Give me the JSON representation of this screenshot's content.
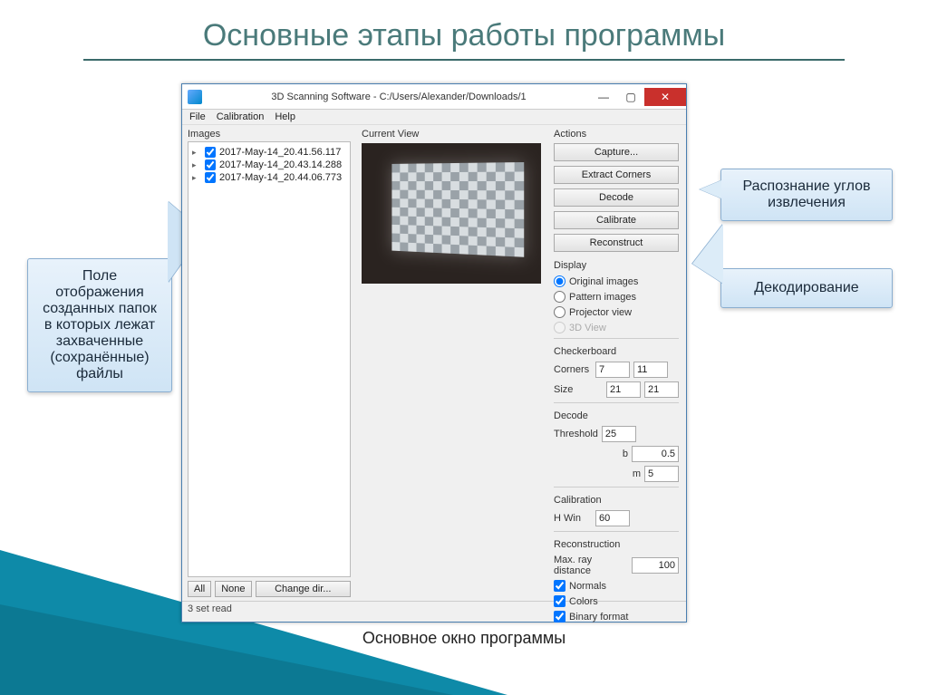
{
  "slide": {
    "title": "Основные этапы работы программы",
    "caption": "Основное окно программы"
  },
  "callouts": {
    "left": "Поле отображения созданных папок в которых лежат захваченные (сохранённые) файлы",
    "r1": "Распознание углов извлечения",
    "r2": "Декодирование"
  },
  "window": {
    "title": "3D Scanning Software - C:/Users/Alexander/Downloads/1",
    "menu": {
      "file": "File",
      "calibration": "Calibration",
      "help": "Help"
    },
    "status": "3 set read"
  },
  "left_panel": {
    "label": "Images",
    "items": [
      "2017-May-14_20.41.56.117",
      "2017-May-14_20.43.14.288",
      "2017-May-14_20.44.06.773"
    ],
    "btn_all": "All",
    "btn_none": "None",
    "btn_change": "Change dir..."
  },
  "mid_panel": {
    "label": "Current View"
  },
  "right_panel": {
    "actions_label": "Actions",
    "btn_capture": "Capture...",
    "btn_extract": "Extract Corners",
    "btn_decode": "Decode",
    "btn_calibrate": "Calibrate",
    "btn_reconstruct": "Reconstruct",
    "display_label": "Display",
    "radio_original": "Original images",
    "radio_pattern": "Pattern images",
    "radio_projector": "Projector view",
    "radio_3d": "3D View",
    "checker_label": "Checkerboard",
    "corners_label": "Corners",
    "corners_x": "7",
    "corners_y": "11",
    "size_label": "Size",
    "size_x": "21",
    "size_y": "21",
    "decode_label": "Decode",
    "threshold_label": "Threshold",
    "threshold": "25",
    "b_label": "b",
    "b": "0.5",
    "m_label": "m",
    "m": "5",
    "calib_label": "Calibration",
    "hwin_label": "H Win",
    "hwin": "60",
    "recon_label": "Reconstruction",
    "maxray_label": "Max. ray distance",
    "maxray": "100",
    "chk_normals": "Normals",
    "chk_colors": "Colors",
    "chk_binary": "Binary format"
  }
}
